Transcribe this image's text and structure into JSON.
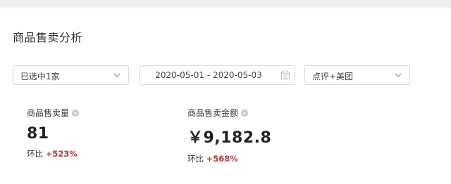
{
  "page": {
    "title": "商品售卖分析"
  },
  "filters": {
    "store_select_value": "已选中1家",
    "date_range": "2020-05-01 - 2020-05-03",
    "platform_select_value": "点评+美团"
  },
  "metrics": [
    {
      "label": "商品售卖量",
      "value": "81",
      "change_label": "环比",
      "change_value": "+523%"
    },
    {
      "label": "商品售卖金额",
      "value": "￥9,182.8",
      "change_label": "环比",
      "change_value": "+568%"
    }
  ],
  "colors": {
    "positive_change": "#b23a3a"
  }
}
